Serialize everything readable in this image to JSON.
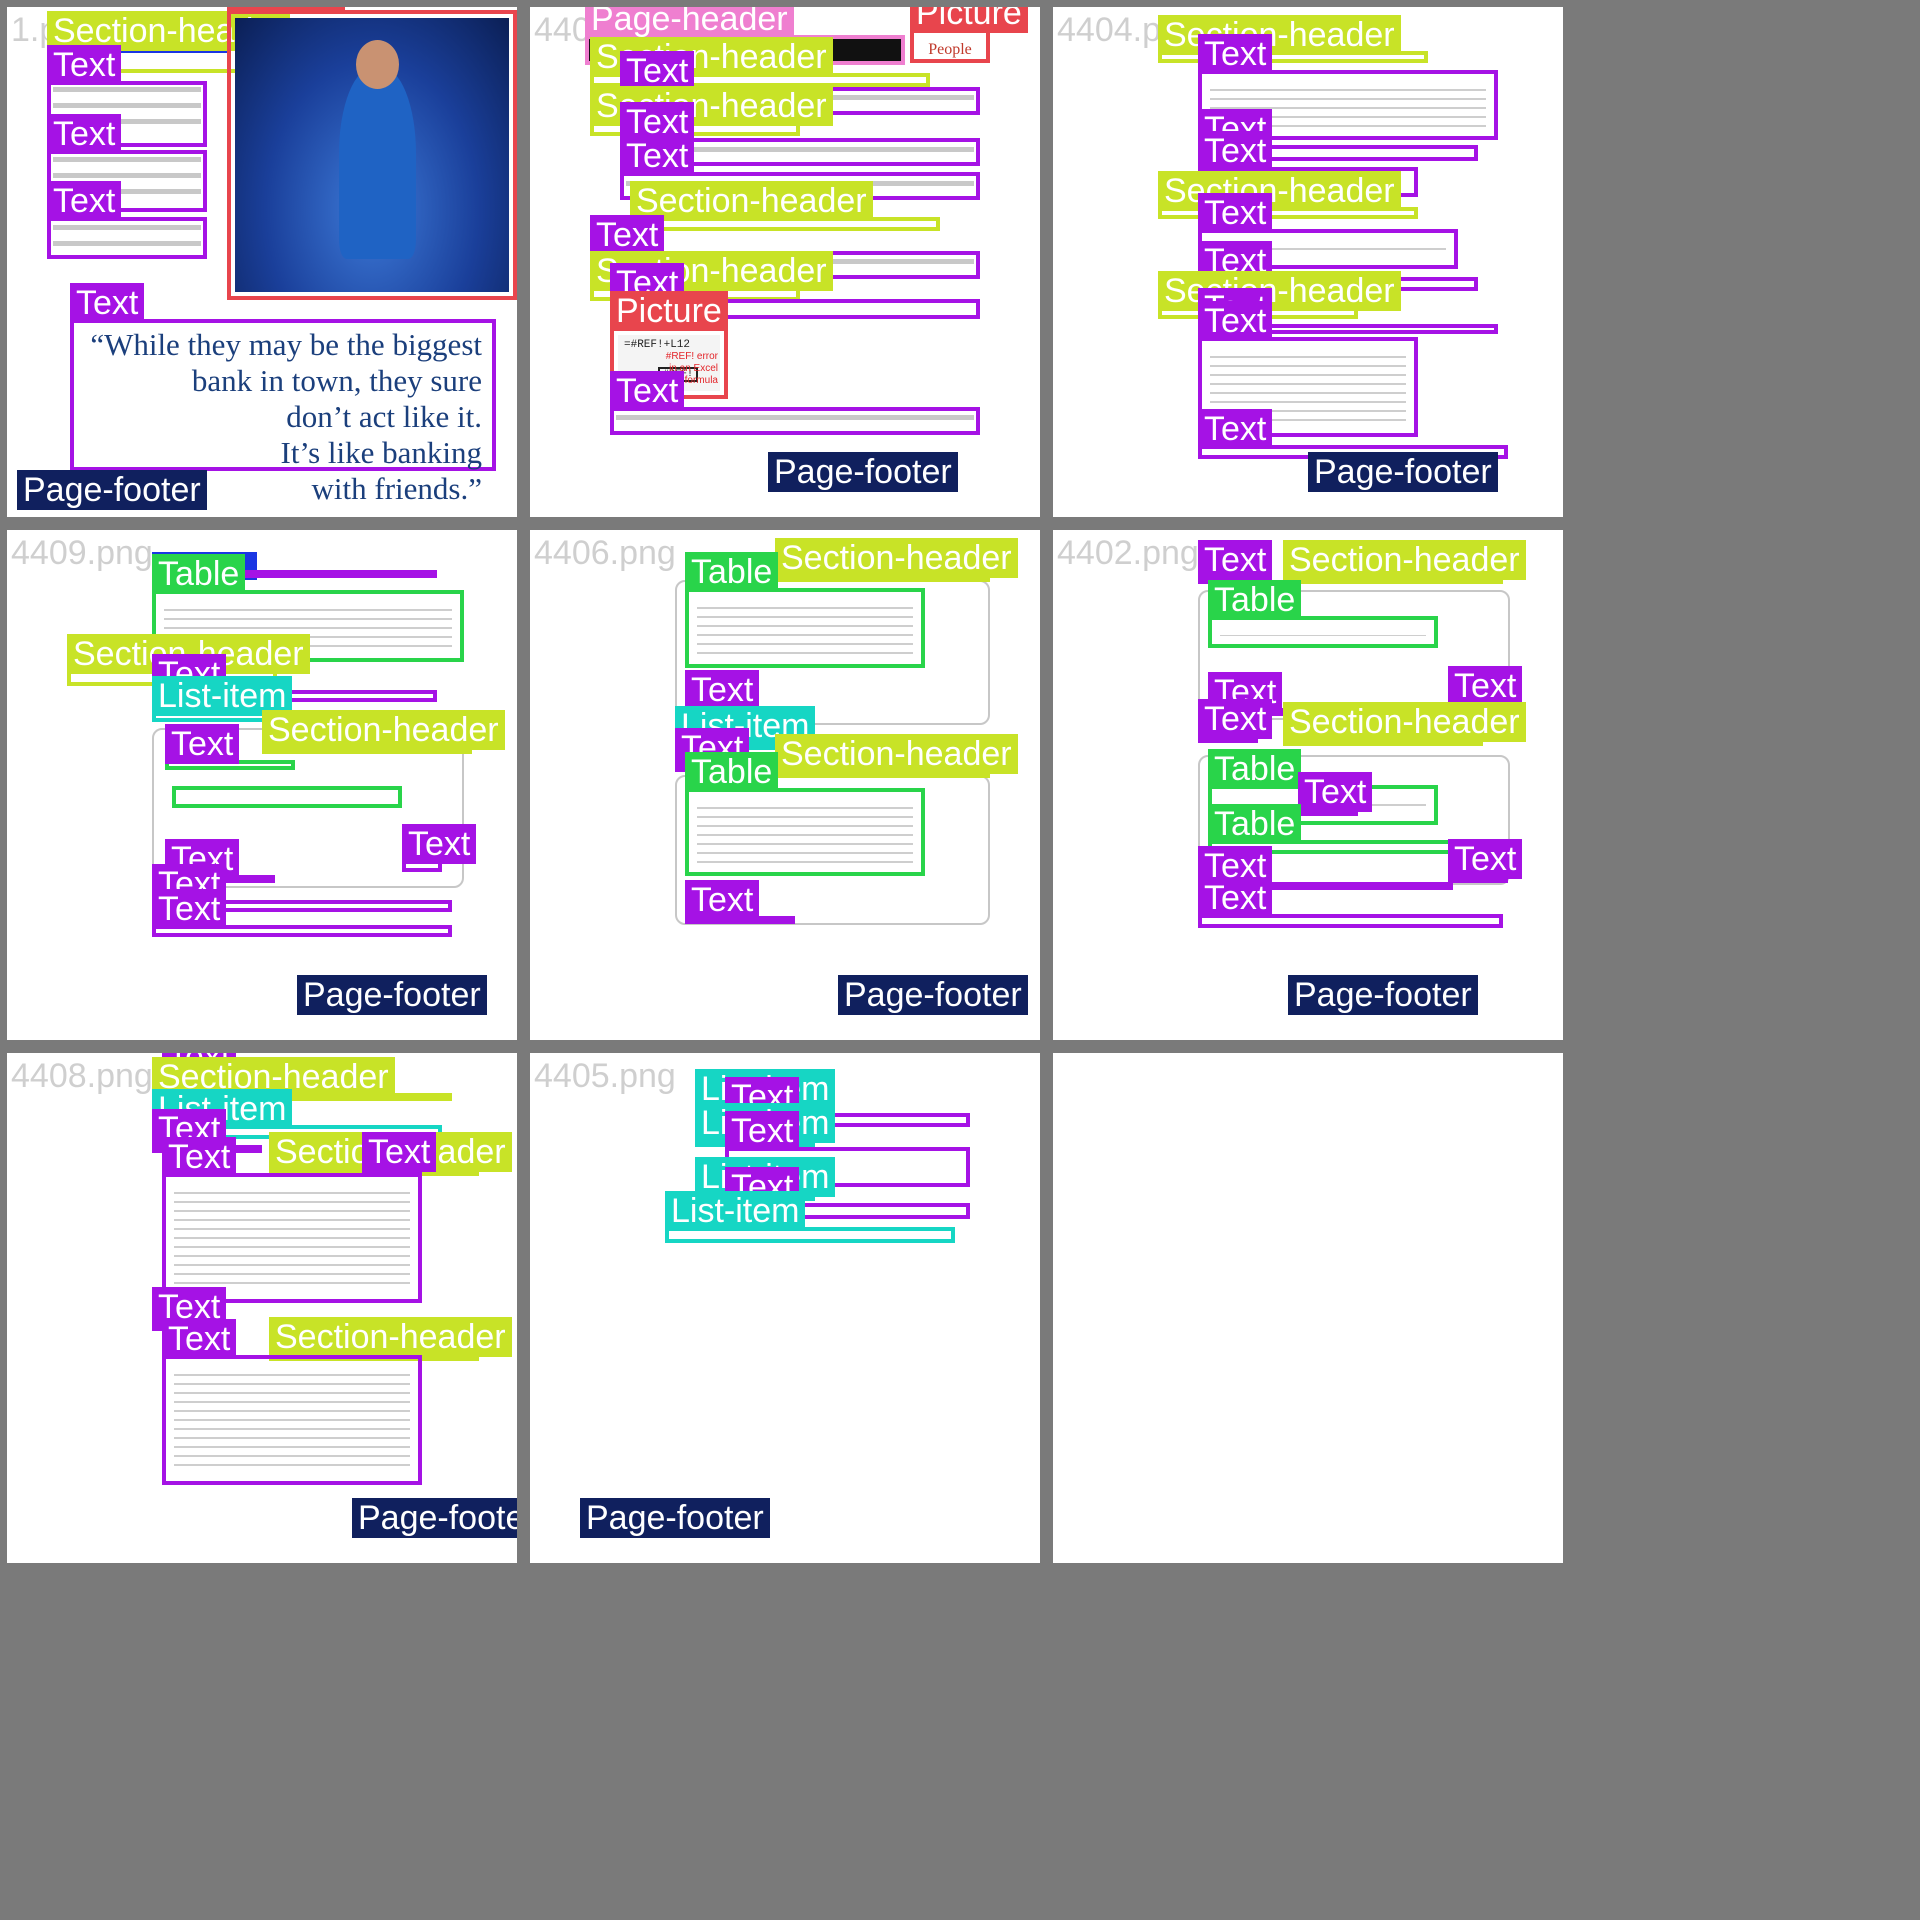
{
  "colors": {
    "background": "#7a7a7a",
    "page": "#ffffff",
    "text": "#a512e5",
    "section_header": "#c8e327",
    "picture": "#e8454d",
    "page_header": "#ef7fd0",
    "page_footer": "#10205e",
    "table": "#29d44a",
    "list_item": "#16d6c4",
    "caption": "#1a36e3"
  },
  "labels": {
    "text": "Text",
    "section_header": "Section-header",
    "picture": "Picture",
    "page_header": "Page-header",
    "page_footer": "Page-footer",
    "table": "Table",
    "list_item": "List-item"
  },
  "tiles": [
    {
      "filename": "1.png"
    },
    {
      "filename": "4407"
    },
    {
      "filename": "4404.png"
    },
    {
      "filename": "4409.png"
    },
    {
      "filename": "4406.png"
    },
    {
      "filename": "4402.png"
    },
    {
      "filename": "4408.png"
    },
    {
      "filename": "4405.png"
    }
  ],
  "tile1": {
    "quote": "“While they may be the biggest\nbank in town, they sure\ndon’t act like it.\nIt’s like banking\nwith friends.”"
  },
  "tile2": {
    "cell_formula": "=#REF!+L12",
    "cell_ref": "#REF!",
    "cell_error": "#REF! error in an Excel formula",
    "logo": "People"
  }
}
